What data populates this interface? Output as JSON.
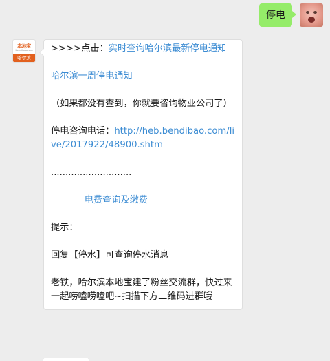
{
  "outgoing": {
    "text": "停电"
  },
  "incoming": {
    "avatar": {
      "brand": "本地宝",
      "url": "Bendibao.com",
      "city": "哈尔滨"
    },
    "line1_prefix": ">>>>点击：",
    "line1_link": "实时查询哈尔滨最新停电通知",
    "line2_link": "哈尔滨一周停电通知",
    "line3": "（如果都没有查到，你就要咨询物业公司了）",
    "line4_prefix": "停电咨询电话：",
    "line4_link": "http://heb.bendibao.com/live/2017922/48900.shtm",
    "dots": "............................",
    "sep_left": "————",
    "sep_link": "电费查询及缴费",
    "sep_right": "————",
    "tip": "提示：",
    "reply": "回复【停水】可查询停水消息",
    "group": "老铁，哈尔滨本地宝建了粉丝交流群，快过来一起唠嗑唠嗑吧~扫描下方二维码进群哦"
  }
}
